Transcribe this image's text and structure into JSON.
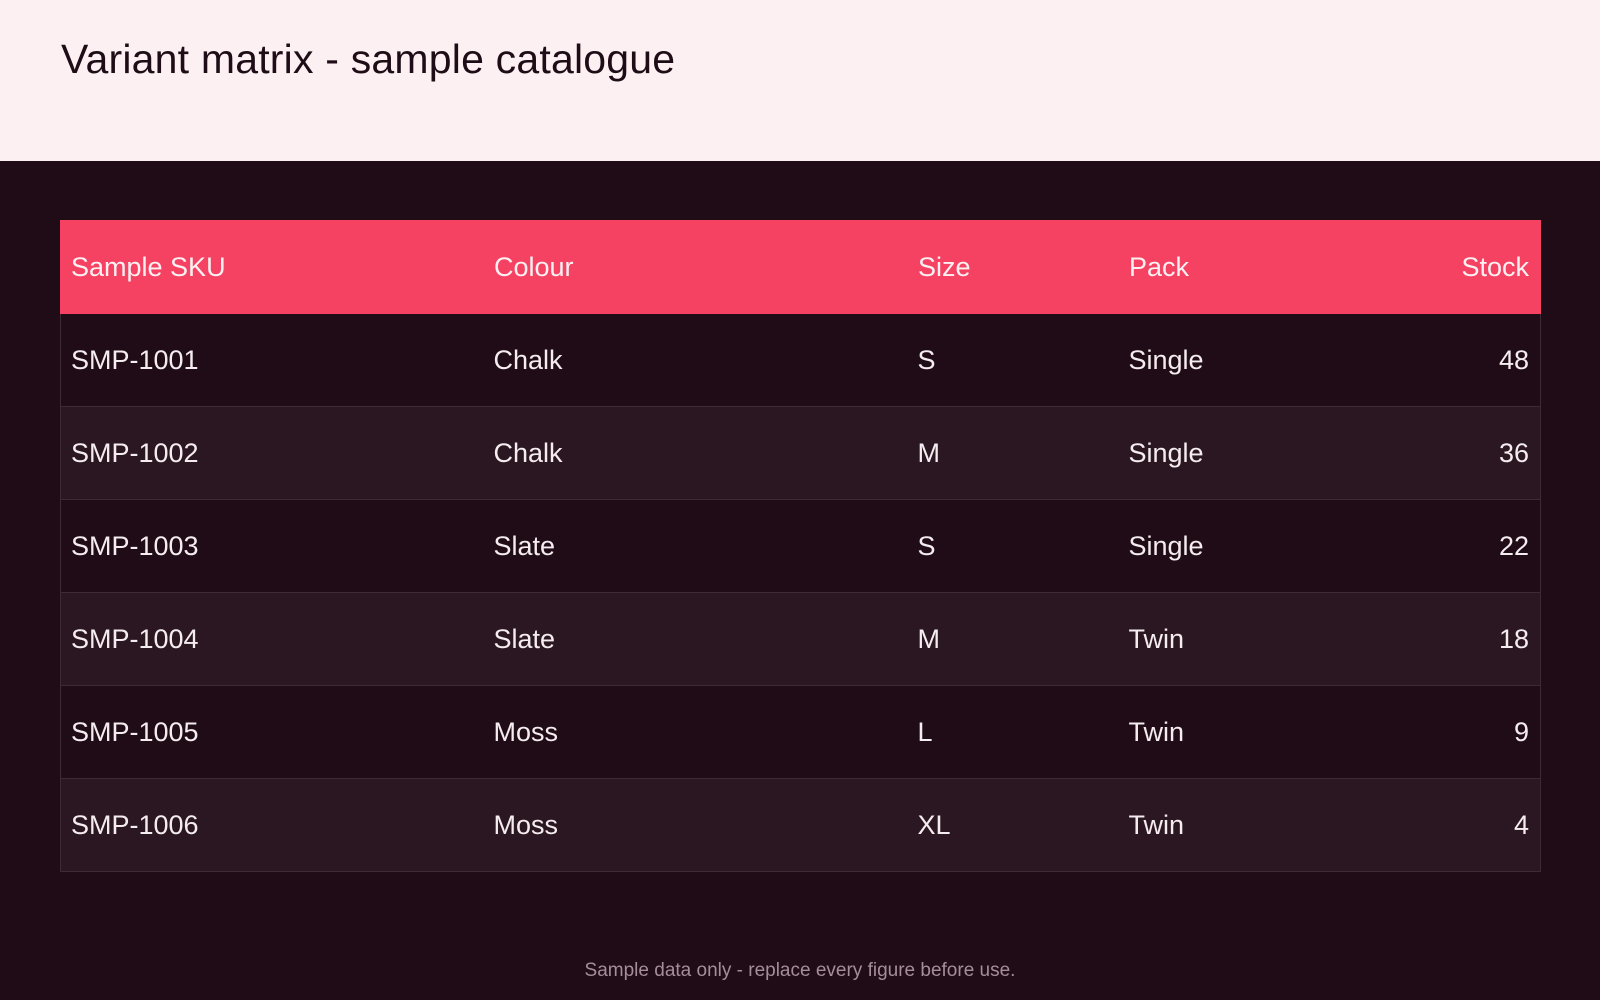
{
  "header": {
    "title": "Variant matrix - sample catalogue"
  },
  "table": {
    "columns": [
      "Sample SKU",
      "Colour",
      "Size",
      "Pack",
      "Stock"
    ],
    "rows": [
      [
        "SMP-1001",
        "Chalk",
        "S",
        "Single",
        "48"
      ],
      [
        "SMP-1002",
        "Chalk",
        "M",
        "Single",
        "36"
      ],
      [
        "SMP-1003",
        "Slate",
        "S",
        "Single",
        "22"
      ],
      [
        "SMP-1004",
        "Slate",
        "M",
        "Twin",
        "18"
      ],
      [
        "SMP-1005",
        "Moss",
        "L",
        "Twin",
        "9"
      ],
      [
        "SMP-1006",
        "Moss",
        "XL",
        "Twin",
        "4"
      ]
    ]
  },
  "footer": {
    "note": "Sample data only - replace every figure before use."
  },
  "colors": {
    "header_background": "#fdf0f3",
    "page_background": "#1f0c17",
    "table_header_accent": "#f54262",
    "row_alt": "#2b1722"
  }
}
